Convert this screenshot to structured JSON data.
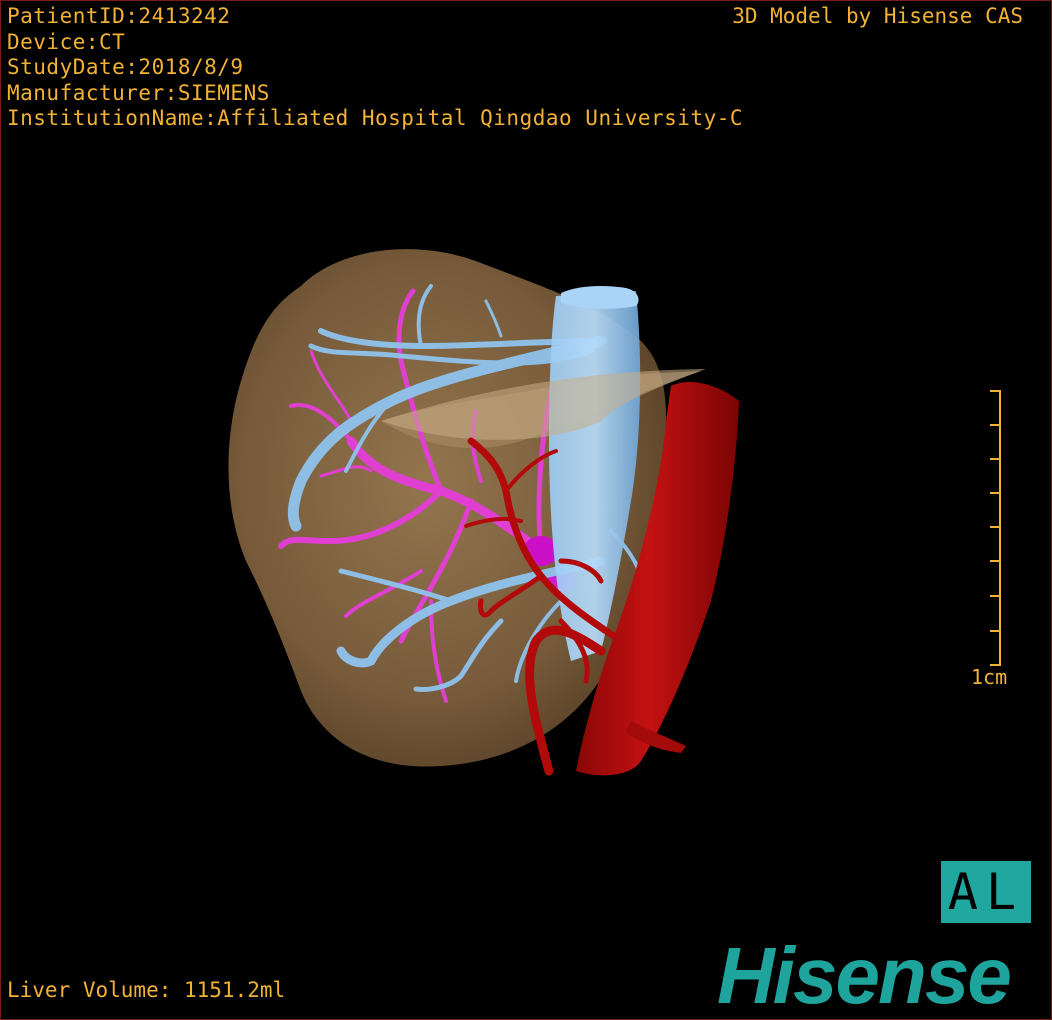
{
  "header": {
    "patient_id": "PatientID:2413242",
    "device": "Device:CT",
    "study_date": "StudyDate:2018/8/9",
    "manufacturer": "Manufacturer:SIEMENS",
    "institution": "InstitutionName:Affiliated Hospital Qingdao University-C"
  },
  "credit": "3D Model by Hisense CAS",
  "measurements": {
    "liver_volume": "Liver Volume: 1151.2ml"
  },
  "scale_bar": {
    "label": "1cm"
  },
  "orientation": {
    "label": "AL"
  },
  "brand": {
    "name": "Hisense"
  },
  "colors": {
    "overlay_text": "#f2b233",
    "liver": "#8a6b44",
    "hepatic_vein": "#8fc3ec",
    "portal_vein": "#e23fd0",
    "artery_aorta": "#b80a0a",
    "brand_teal": "#1fa39d"
  }
}
